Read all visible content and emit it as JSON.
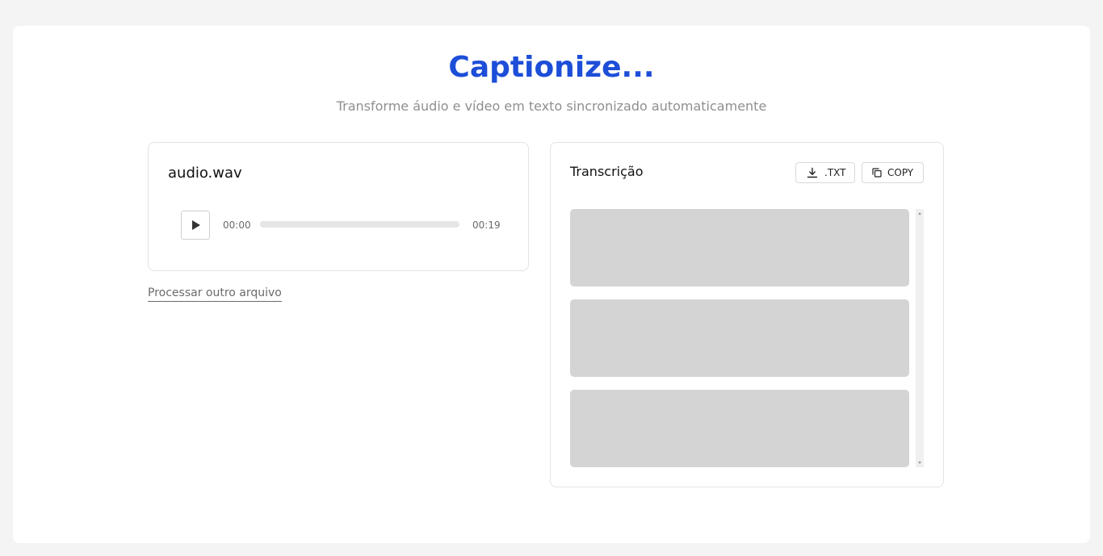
{
  "header": {
    "title": "Captionize...",
    "subtitle": "Transforme áudio e vídeo em texto sincronizado automaticamente"
  },
  "player": {
    "file_name": "audio.wav",
    "current_time": "00:00",
    "total_time": "00:19",
    "progress": 0
  },
  "process_link": "Processar outro arquivo",
  "transcript": {
    "title": "Transcrição",
    "download_label": ".TXT",
    "copy_label": "COPY",
    "skeleton_count": 3
  },
  "icons": {
    "play": "play-icon",
    "download": "download-icon",
    "copy": "copy-icon"
  },
  "colors": {
    "accent": "#1d4ed8",
    "skeleton": "#d4d4d4",
    "muted_text": "#8f8f8f"
  }
}
